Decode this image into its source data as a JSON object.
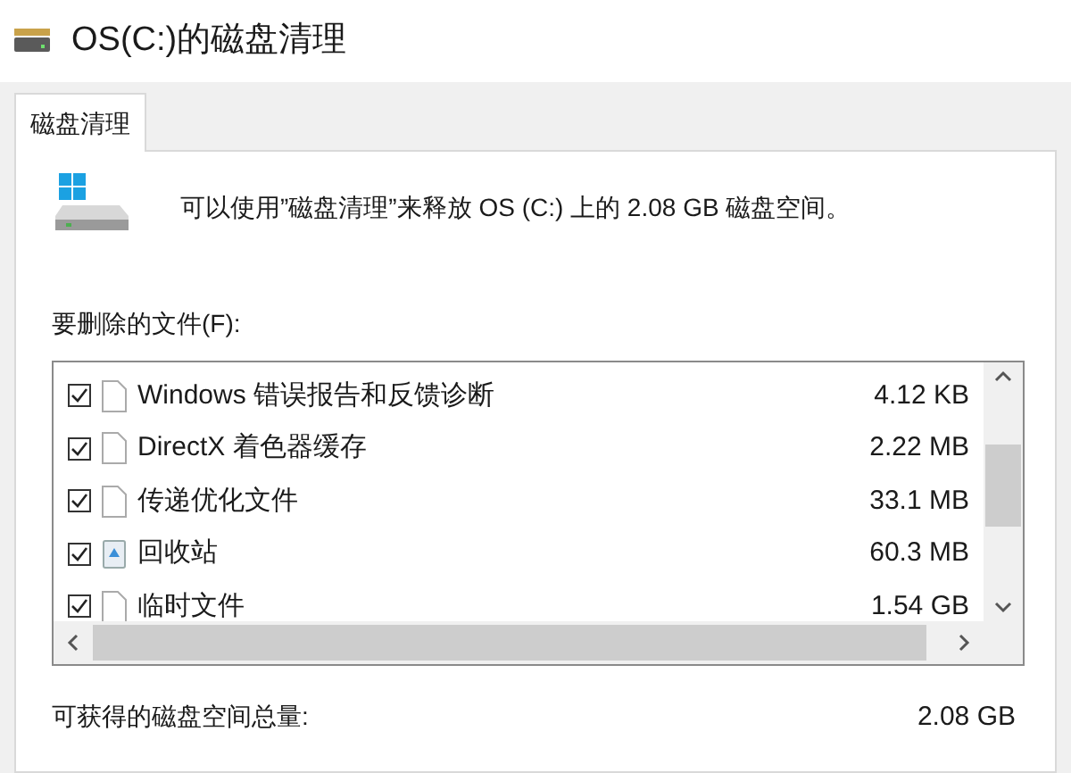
{
  "window": {
    "title": "OS(C:)的磁盘清理"
  },
  "tabs": [
    {
      "label": "磁盘清理",
      "selected": true
    }
  ],
  "description": "可以使用”磁盘清理”来释放 OS (C:) 上的 2.08 GB 磁盘空间。",
  "files_label": "要删除的文件(F):",
  "files": [
    {
      "name": "Windows 错误报告和反馈诊断",
      "size": "4.12 KB",
      "checked": true,
      "kind": "file"
    },
    {
      "name": "DirectX 着色器缓存",
      "size": "2.22 MB",
      "checked": true,
      "kind": "file"
    },
    {
      "name": "传递优化文件",
      "size": "33.1 MB",
      "checked": true,
      "kind": "file"
    },
    {
      "name": "回收站",
      "size": "60.3 MB",
      "checked": true,
      "kind": "recycle"
    },
    {
      "name": "临时文件",
      "size": "1.54 GB",
      "checked": true,
      "kind": "file"
    }
  ],
  "total": {
    "label": "可获得的磁盘空间总量:",
    "value": "2.08 GB"
  }
}
